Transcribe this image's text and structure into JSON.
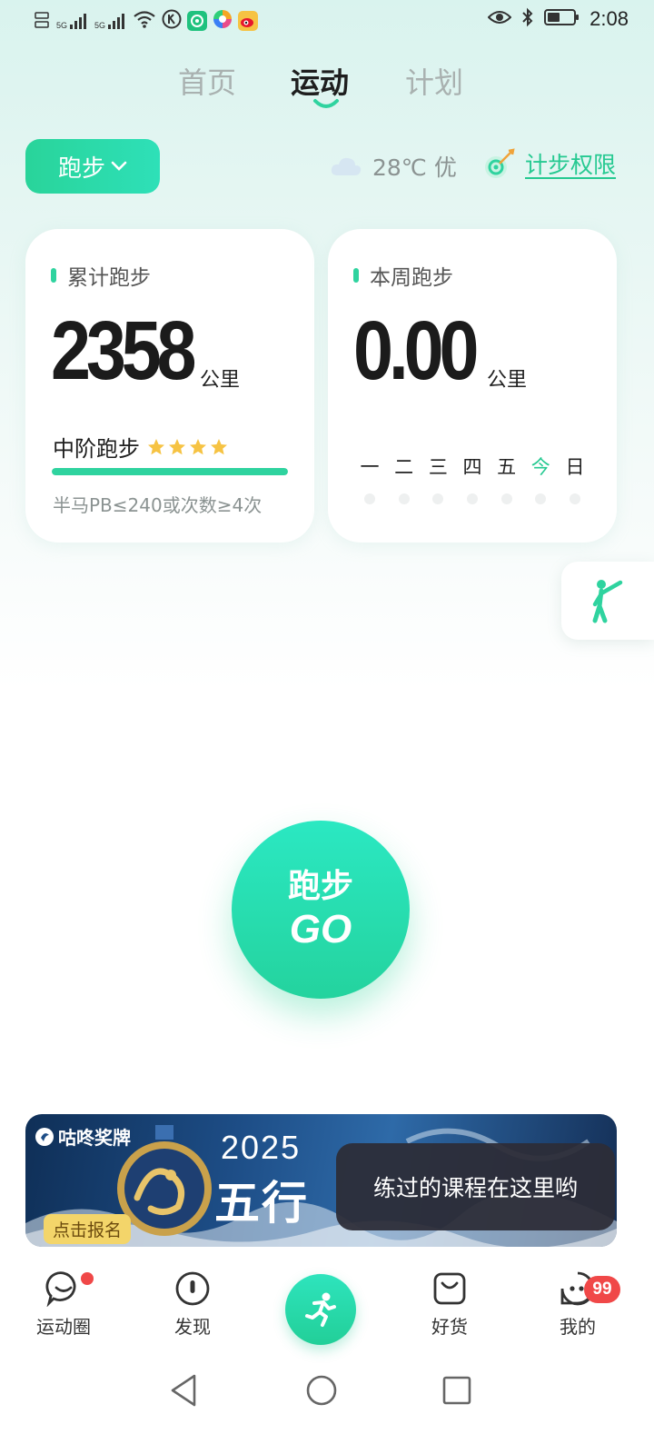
{
  "status_bar": {
    "time": "2:08",
    "signal1": "5G",
    "signal2": "5G",
    "icons": [
      "hd-icon",
      "signal-icon",
      "wifi-icon",
      "k-app-icon",
      "keep-app-icon",
      "colorful-app-icon",
      "weibo-icon",
      "eye-icon",
      "bluetooth-icon",
      "battery-icon"
    ]
  },
  "tabs": [
    {
      "label": "首页",
      "active": false
    },
    {
      "label": "运动",
      "active": true
    },
    {
      "label": "计划",
      "active": false
    }
  ],
  "filter": {
    "sport": "跑步",
    "weather": "28℃ 优",
    "permission": "计步权限"
  },
  "total_card": {
    "title": "累计跑步",
    "value": "2358",
    "unit": "公里",
    "level": "中阶跑步",
    "stars": 4,
    "progress": 1.0,
    "hint": "半马PB≤240或次数≥4次"
  },
  "week_card": {
    "title": "本周跑步",
    "value": "0.00",
    "unit": "公里",
    "days": [
      "一",
      "二",
      "三",
      "四",
      "五",
      "今",
      "日"
    ],
    "today_index": 5
  },
  "go_button": {
    "top": "跑步",
    "bottom": "GO"
  },
  "banner": {
    "brand": "咕咚奖牌",
    "year": "2025",
    "title": "五行",
    "cta": "点击报名"
  },
  "toast": "练过的课程在这里哟",
  "bottom_nav": [
    {
      "label": "运动圈",
      "icon": "chat-bubble-icon"
    },
    {
      "label": "发现",
      "icon": "compass-icon"
    },
    {
      "label": "",
      "icon": "runner-icon"
    },
    {
      "label": "好货",
      "icon": "shopping-bag-icon"
    },
    {
      "label": "我的",
      "icon": "face-icon",
      "badge": "99"
    }
  ],
  "colors": {
    "accent": "#2fd39f",
    "accent_text": "#25c991",
    "badge": "#f04848"
  }
}
